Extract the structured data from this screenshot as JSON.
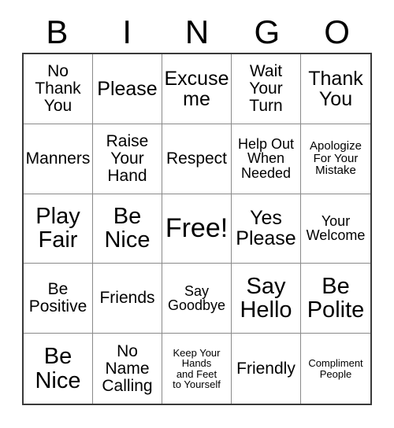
{
  "card": {
    "header_letters": [
      "B",
      "I",
      "N",
      "G",
      "O"
    ],
    "colors": {
      "background": "#ffffff",
      "text": "#000000",
      "outer_border": "#3a3a3a",
      "inner_gridline": "#8a8a8a"
    },
    "rows": [
      [
        {
          "text": "No\nThank\nYou",
          "size": "md"
        },
        {
          "text": "Please",
          "size": "lg"
        },
        {
          "text": "Excuse\nme",
          "size": "lg"
        },
        {
          "text": "Wait\nYour\nTurn",
          "size": "md"
        },
        {
          "text": "Thank\nYou",
          "size": "lg"
        }
      ],
      [
        {
          "text": "Manners",
          "size": "md"
        },
        {
          "text": "Raise\nYour\nHand",
          "size": "md"
        },
        {
          "text": "Respect",
          "size": "md"
        },
        {
          "text": "Help Out\nWhen\nNeeded",
          "size": "sm"
        },
        {
          "text": "Apologize\nFor Your\nMistake",
          "size": "xs"
        }
      ],
      [
        {
          "text": "Play\nFair",
          "size": "xl"
        },
        {
          "text": "Be\nNice",
          "size": "xl"
        },
        {
          "text": "Free!",
          "size": "xxl"
        },
        {
          "text": "Yes\nPlease",
          "size": "lg"
        },
        {
          "text": "Your\nWelcome",
          "size": "sm"
        }
      ],
      [
        {
          "text": "Be\nPositive",
          "size": "md"
        },
        {
          "text": "Friends",
          "size": "md"
        },
        {
          "text": "Say\nGoodbye",
          "size": "sm"
        },
        {
          "text": "Say\nHello",
          "size": "xl"
        },
        {
          "text": "Be\nPolite",
          "size": "xl"
        }
      ],
      [
        {
          "text": "Be\nNice",
          "size": "xl"
        },
        {
          "text": "No\nName\nCalling",
          "size": "md"
        },
        {
          "text": "Keep Your\nHands\nand Feet\nto Yourself",
          "size": "xxs"
        },
        {
          "text": "Friendly",
          "size": "md"
        },
        {
          "text": "Compliment\nPeople",
          "size": "xxs"
        }
      ]
    ]
  }
}
